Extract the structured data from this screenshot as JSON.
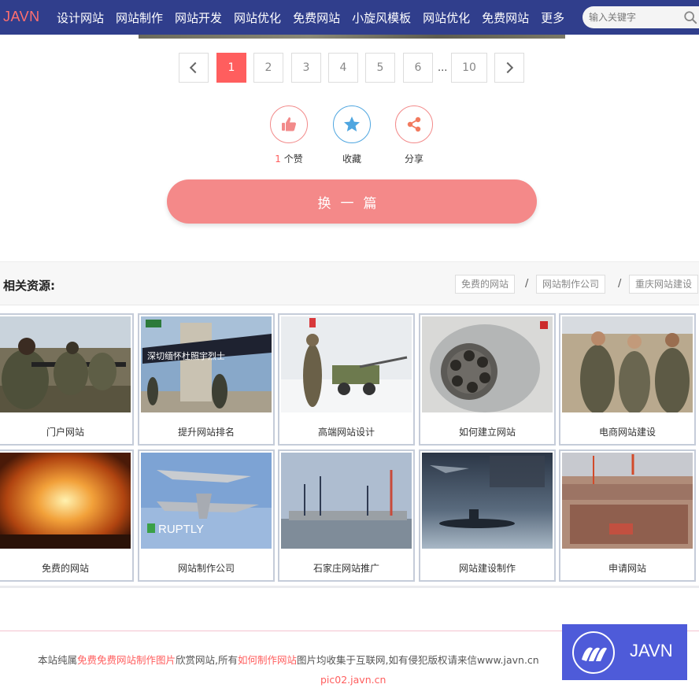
{
  "nav": {
    "logo": "JAVN",
    "items": [
      "设计网站",
      "网站制作",
      "网站开发",
      "网站优化",
      "免费网站",
      "小旋风模板",
      "网站优化",
      "免费网站",
      "更多"
    ],
    "search_placeholder": "输入关键字"
  },
  "pagination": {
    "pages": [
      "1",
      "2",
      "3",
      "4",
      "5",
      "6"
    ],
    "dots": "...",
    "last": "10",
    "current": "1"
  },
  "actions": {
    "like_count": "1",
    "like_suffix": "个赞",
    "favorite": "收藏",
    "share": "分享"
  },
  "switch_button": "换一篇",
  "related": {
    "title": "相关资源:",
    "tags": [
      "免费的网站",
      "网站制作公司",
      "重庆网站建设"
    ],
    "separator": "/",
    "cards": [
      {
        "caption": "门户网站"
      },
      {
        "caption": "提升网站排名"
      },
      {
        "caption": "高端网站设计"
      },
      {
        "caption": "如何建立网站"
      },
      {
        "caption": "电商网站建设"
      },
      {
        "caption": "免费的网站"
      },
      {
        "caption": "网站制作公司"
      },
      {
        "caption": "石家庄网站推广"
      },
      {
        "caption": "网站建设制作"
      },
      {
        "caption": "申请网站"
      }
    ],
    "image_text": {
      "banner": "深切缅怀杜照宇烈士",
      "ruptly": "RUPTLY"
    }
  },
  "footer": {
    "part1": "本站纯属",
    "link1": "免费免费网站制作图片",
    "part2": "欣赏网站,所有",
    "link2": "如何制作网站",
    "part3": "图片均收集于互联网,如有侵犯版权请来信www.javn.cn",
    "domain": "pic02.javn.cn"
  },
  "badge": {
    "text": "JAVN"
  },
  "colors": {
    "nav": "#303e8c",
    "accent": "#ff5e5e",
    "button": "#f48989",
    "badge": "#4e5bd9"
  }
}
